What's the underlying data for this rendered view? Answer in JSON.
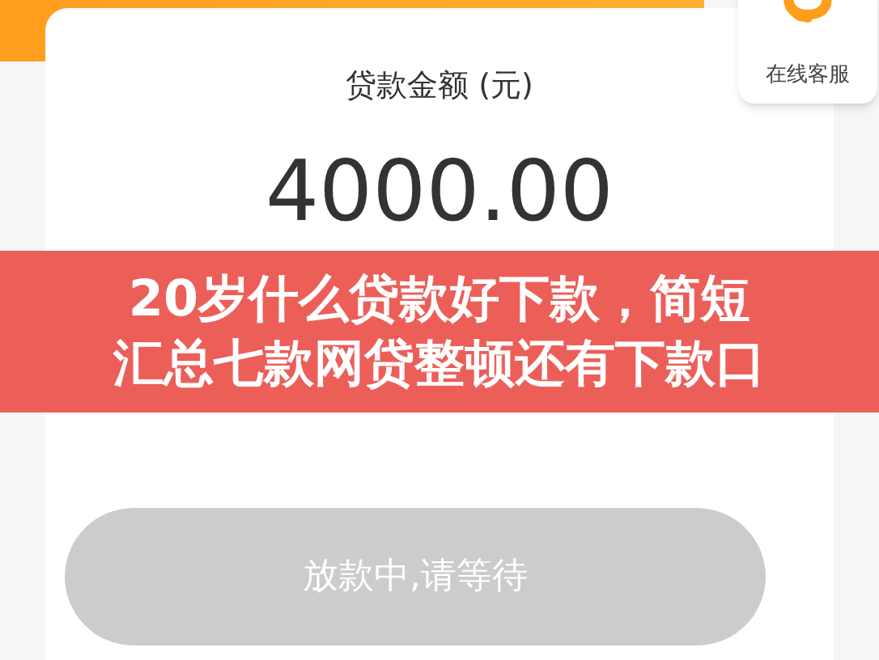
{
  "support": {
    "label": "在线客服"
  },
  "loan": {
    "label": "贷款金额 (元)",
    "amount": "4000.00"
  },
  "banner": {
    "lines": [
      "20岁什么贷款好下款，简短",
      "汇总七款网贷整顿还有下款口"
    ]
  },
  "status_button": {
    "label": "放款中,请等待",
    "disabled": true
  }
}
